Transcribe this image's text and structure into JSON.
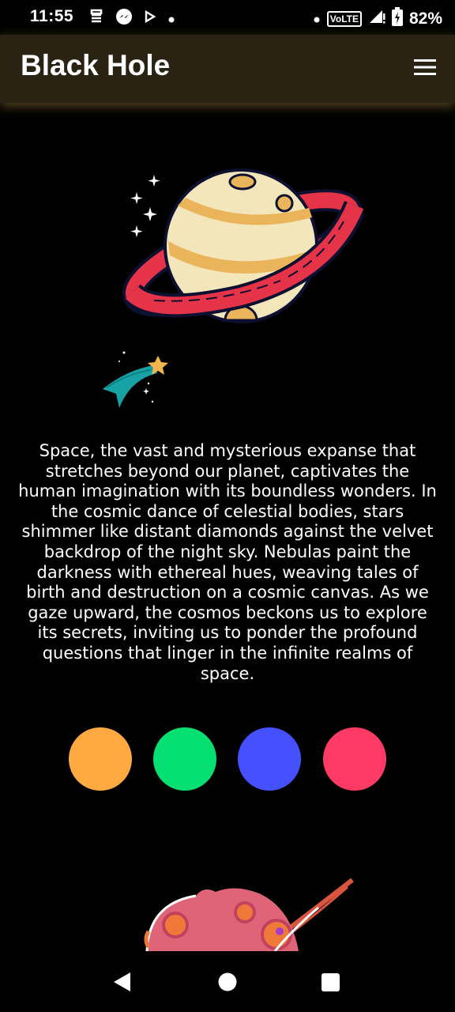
{
  "status_bar": {
    "time": "11:55",
    "battery": "82%",
    "left_icons": [
      "app-icon",
      "messenger-icon",
      "play-icon",
      "dot-icon"
    ],
    "right_icons": [
      "dot-icon",
      "volte-icon",
      "signal-icon",
      "battery-icon"
    ],
    "volte_label": "VoLTE"
  },
  "app_bar": {
    "title": "Black Hole",
    "menu_icon": "hamburger-menu-icon"
  },
  "illustrations": [
    "saturn-planet-illustration",
    "shooting-star-illustration",
    "pink-planet-illustration"
  ],
  "content": {
    "paragraph": "Space, the vast and mysterious expanse that stretches beyond our planet, captivates the human imagination with its boundless wonders. In the cosmic dance of celestial bodies, stars shimmer like distant diamonds against the velvet backdrop of the night sky. Nebulas paint the darkness with ethereal hues, weaving tales of birth and destruction on a cosmic canvas. As we gaze upward, the cosmos beckons us to explore its secrets, inviting us to ponder the profound questions that linger in the infinite realms of space."
  },
  "color_swatches": [
    {
      "name": "orange",
      "color": "#FFA940"
    },
    {
      "name": "green",
      "color": "#06E073"
    },
    {
      "name": "blue",
      "color": "#4550FF"
    },
    {
      "name": "red",
      "color": "#FF3B65"
    }
  ],
  "nav_bar": {
    "buttons": [
      "back-icon",
      "home-icon",
      "recents-icon"
    ]
  }
}
